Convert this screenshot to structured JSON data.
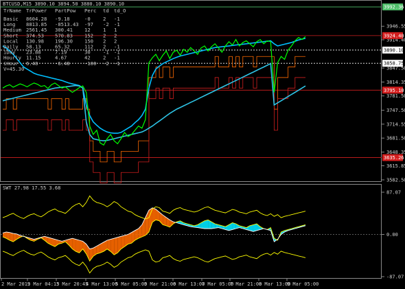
{
  "chart_data": [
    {
      "type": "line",
      "title": "BTCUSD,M15  3890.10 3894.50 3880.10 3890.10",
      "symbol": "BTCUSD,M15",
      "ohlc": {
        "open": "3890.10",
        "high": "3894.50",
        "low": "3880.10",
        "close": "3890.10"
      },
      "ylim": [
        3582.5,
        3992.5
      ],
      "y_ticks": [
        "3946.55",
        "3914.40",
        "3847.50",
        "3814.35",
        "3781.50",
        "3747.50",
        "3714.55",
        "3681.50",
        "3648.35",
        "3615.85",
        "3582.50"
      ],
      "price_tags": [
        {
          "value": "3992.36",
          "color": "#4fbf6a"
        },
        {
          "value": "3924.40",
          "color": "#d21e1e"
        },
        {
          "value": "3890.10",
          "color": "#ffffff"
        },
        {
          "value": "3858.75",
          "color": "#ffffff"
        },
        {
          "value": "3795.10",
          "color": "#d21e1e"
        },
        {
          "value": "3635.26",
          "color": "#d21e1e"
        }
      ],
      "series": [
        {
          "values": [
            3800,
            3805,
            3808,
            3802,
            3806,
            3810,
            3807,
            3803,
            3808,
            3812,
            3809,
            3804,
            3806,
            3799,
            3808,
            3812,
            3806,
            3800,
            3803,
            3796,
            3790,
            3795,
            3801,
            3805,
            3790,
            3710,
            3690,
            3700,
            3670,
            3665,
            3680,
            3690,
            3675,
            3668,
            3680,
            3695,
            3685,
            3690,
            3700,
            3710,
            3705,
            3725,
            3860,
            3872,
            3880,
            3865,
            3878,
            3888,
            3870,
            3885,
            3890,
            3878,
            3892,
            3885,
            3896,
            3888,
            3880,
            3895,
            3900,
            3888,
            3898,
            3905,
            3895,
            3885,
            3900,
            3910,
            3902,
            3915,
            3900,
            3908,
            3912,
            3905,
            3898,
            3910,
            3915,
            3905,
            3912,
            3910,
            3790,
            3860,
            3875,
            3868,
            3890,
            3900,
            3912,
            3920,
            3915,
            3922
          ]
        },
        {
          "values": [
            3900,
            3895,
            3888,
            3880,
            3870,
            3860,
            3850,
            3845,
            3840,
            3835,
            3832,
            3830,
            3828,
            3826,
            3824,
            3822,
            3820,
            3818,
            3815,
            3812,
            3810,
            3808,
            3806,
            3800,
            3760,
            3735,
            3720,
            3712,
            3705,
            3700,
            3696,
            3694,
            3693,
            3693,
            3695,
            3700,
            3705,
            3710,
            3718,
            3725,
            3735,
            3750,
            3800,
            3830,
            3845,
            3852,
            3858,
            3862,
            3866,
            3870,
            3873,
            3876,
            3878,
            3880,
            3882,
            3884,
            3886,
            3888,
            3890,
            3892,
            3894,
            3896,
            3897,
            3898,
            3899,
            3900,
            3901,
            3902,
            3903,
            3904,
            3905,
            3906,
            3907,
            3908,
            3909,
            3910,
            3911,
            3912,
            3905,
            3900,
            3902,
            3904,
            3906,
            3908,
            3911,
            3914,
            3916,
            3918
          ]
        },
        {
          "values": [
            3770,
            3772,
            3774,
            3776,
            3778,
            3780,
            3782,
            3784,
            3786,
            3788,
            3790,
            3792,
            3794,
            3796,
            3798,
            3800,
            3801,
            3802,
            3803,
            3804,
            3805,
            3806,
            3805,
            3800,
            3720,
            3690,
            3680,
            3678,
            3676,
            3675,
            3676,
            3678,
            3680,
            3682,
            3684,
            3686,
            3688,
            3690,
            3692,
            3694,
            3696,
            3700,
            3705,
            3710,
            3716,
            3722,
            3728,
            3734,
            3740,
            3745,
            3750,
            3754,
            3758,
            3762,
            3766,
            3770,
            3774,
            3778,
            3782,
            3786,
            3790,
            3794,
            3798,
            3802,
            3806,
            3810,
            3814,
            3818,
            3822,
            3826,
            3830,
            3834,
            3838,
            3842,
            3846,
            3850,
            3854,
            3858,
            3760,
            3765,
            3770,
            3775,
            3780,
            3785,
            3790,
            3795,
            3800,
            3805
          ]
        }
      ]
    },
    {
      "type": "area",
      "title": "SWT 27.98 17.55 3.68",
      "ylim": [
        -87.07,
        87.07
      ],
      "y_ticks": [
        "87.07",
        "0.00",
        "-87.07"
      ],
      "series": [
        {
          "values": [
            -5,
            -8,
            -12,
            -15,
            -10,
            -6,
            -3,
            -8,
            -12,
            -14,
            -10,
            -7,
            -12,
            -18,
            -22,
            -25,
            -20,
            -18,
            -15,
            -22,
            -30,
            -35,
            -38,
            -30,
            -40,
            -55,
            -45,
            -40,
            -38,
            -35,
            -30,
            -35,
            -42,
            -38,
            -30,
            -25,
            -20,
            -18,
            -12,
            -8,
            -5,
            -2,
            5,
            25,
            30,
            28,
            20,
            18,
            15,
            22,
            26,
            28,
            24,
            22,
            20,
            18,
            20,
            24,
            28,
            30,
            26,
            22,
            20,
            18,
            16,
            20,
            24,
            22,
            18,
            16,
            14,
            18,
            20,
            22,
            16,
            12,
            10,
            14,
            -8,
            -12,
            5,
            8,
            10,
            12,
            14,
            16,
            18,
            20
          ]
        },
        {
          "values": [
            3,
            5,
            4,
            2,
            1,
            -2,
            -4,
            -6,
            -8,
            -10,
            -8,
            -6,
            -4,
            -6,
            -8,
            -10,
            -12,
            -14,
            -12,
            -10,
            -8,
            -10,
            -12,
            -14,
            -20,
            -30,
            -28,
            -24,
            -20,
            -16,
            -12,
            -10,
            -8,
            -6,
            -4,
            -2,
            0,
            4,
            8,
            12,
            20,
            35,
            50,
            55,
            52,
            46,
            40,
            35,
            30,
            26,
            24,
            22,
            20,
            18,
            16,
            15,
            14,
            13,
            12,
            12,
            12,
            13,
            14,
            12,
            10,
            8,
            10,
            12,
            14,
            12,
            10,
            8,
            6,
            8,
            10,
            12,
            10,
            8,
            -15,
            -10,
            0,
            5,
            8,
            10,
            12,
            14,
            16,
            18
          ]
        }
      ]
    }
  ],
  "stats_table": {
    "headers": [
      "TrName",
      "TrPower",
      "PartPow",
      "Perc",
      "td",
      "td_O"
    ],
    "rows": [
      [
        "Basic",
        "8604.28",
        "-9.18",
        "-0",
        "2",
        "-1"
      ],
      [
        "Long",
        "8813.85",
        "-8513.43",
        "-97",
        "-2",
        "-1"
      ],
      [
        "Medium",
        "2561.45",
        "300.41",
        "12",
        "1",
        "1"
      ],
      [
        "Short",
        "374.53",
        "570.83",
        "152",
        "2",
        "2"
      ],
      [
        "Local",
        "130.98",
        "196.30",
        "150",
        "2",
        "2"
      ],
      [
        "Daily",
        "58.13",
        "65.32",
        "112",
        "2",
        "-1"
      ],
      [
        "iDay",
        "23.88",
        "7.19",
        "30",
        "-1",
        "-1"
      ],
      [
        "Hourly",
        "11.15",
        "4.67",
        "42",
        "2",
        "-1"
      ],
      [
        "iHour",
        "6.48",
        "-6.48",
        "-100",
        "-2",
        "-1"
      ]
    ],
    "footer": "V=45.30"
  },
  "x_ticks": [
    "2 Mar 2019",
    "3 Mar 04:15",
    "3 Mar 20:45",
    "4 Mar 13:00",
    "5 Mar 05:00",
    "5 Mar 21:00",
    "6 Mar 13:00",
    "7 Mar 05:00",
    "7 Mar 21:00",
    "8 Mar 13:00",
    "9 Mar 05:00"
  ],
  "colors": {
    "price": "#00ff00",
    "ma_fast": "#00bfff",
    "ma_slow": "#2ec4e6",
    "level_red": "#d21e1e",
    "level_orange": "#ff6a00",
    "band_yellow": "#ffff00",
    "fill_cyan": "#00e5ff",
    "fill_orange": "#ff6a00"
  }
}
